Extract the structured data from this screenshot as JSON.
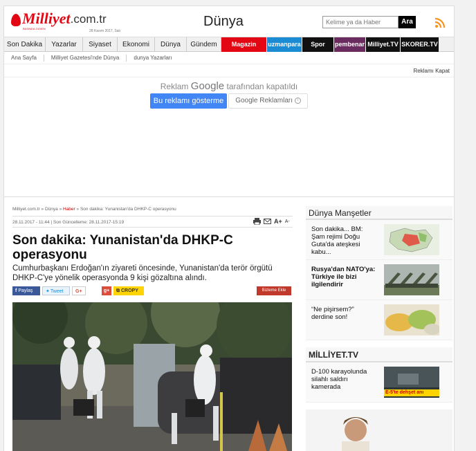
{
  "header": {
    "logo_text": "Milliyet",
    "logo_domain": ".com.tr",
    "logo_sub": "BASINDA GÜVEN",
    "date": "28 Kasım 2017, Salı",
    "section_title": "Dünya",
    "search_placeholder": "Kelime ya da Haber",
    "search_button": "Ara"
  },
  "nav": {
    "items": [
      {
        "label": "Son Dakika",
        "w": 60
      },
      {
        "label": "Yazarlar",
        "w": 54
      },
      {
        "label": "Siyaset",
        "w": 50
      },
      {
        "label": "Ekonomi",
        "w": 54
      },
      {
        "label": "Dünya",
        "w": 46
      },
      {
        "label": "Gündem",
        "w": 50
      }
    ],
    "specials": [
      {
        "label": "Magazin",
        "color": "#e30613"
      },
      {
        "label": "uzmanpara",
        "color": "#1b8bd4"
      },
      {
        "label": "Spor",
        "color": "#111111"
      },
      {
        "label": "pembenar",
        "color": "#6a2c5f"
      },
      {
        "label": "Milliyet.TV",
        "color": "#111111"
      },
      {
        "label": "SKORER.TV",
        "color": "#111111"
      }
    ]
  },
  "breadcrumbs": [
    "Ana Sayfa",
    "Milliyet Gazetesi'nde Dünya",
    "dunya Yazarları"
  ],
  "ad": {
    "close": "Reklamı Kapat",
    "message_prefix": "Reklam",
    "message_brand": "Google",
    "message_suffix": "tarafından kapatıldı",
    "show_button": "Bu reklamı gösterme",
    "google_ads_button": "Google Reklamları"
  },
  "article": {
    "crumb_site": "Milliyet.com.tr",
    "crumb_section": "Dünya",
    "crumb_news": "Haber",
    "crumb_current": "Son dakika: Yunanistan'da DHKP-C operasyonu",
    "meta": "28.11.2017 - 11:44 | Son Güncelleme: 28.11.2017-15:19",
    "title": "Son dakika: Yunanistan'da DHKP-C operasyonu",
    "lead": "Cumhurbaşkanı Erdoğan'ın ziyareti öncesinde, Yunanistan'da terör örgütü DHKP-C'ye yönelik operasyonda 9 kişi gözaltına alındı.",
    "share_facebook": "Paylaş",
    "share_twitter": "Tweet",
    "share_gplus": "G+",
    "share_gplus2": "g+",
    "share_copy": "CROPY",
    "add_fav": "Bizleme Ekle",
    "font_plus": "A+",
    "font_minus": "A-"
  },
  "sidebar": {
    "title": "Dünya Manşetler",
    "items": [
      {
        "text": "Son dakika... BM: Şam rejimi Doğu Guta'da ateşkesi kabu..."
      },
      {
        "text": "Rusya'dan NATO'ya: Türkiye ile bizi ilgilendirir"
      },
      {
        "text": "“Ne pişirsem?” derdine son!"
      }
    ],
    "tv_title": "MİLLİYET.TV",
    "tv_items": [
      {
        "text": "D-100 karayolunda silahlı saldırı kamerada",
        "thumb_caption": "E-5'te dehşet anı"
      }
    ]
  },
  "colors": {
    "brand_red": "#e30613",
    "google_blue": "#4285f4"
  }
}
